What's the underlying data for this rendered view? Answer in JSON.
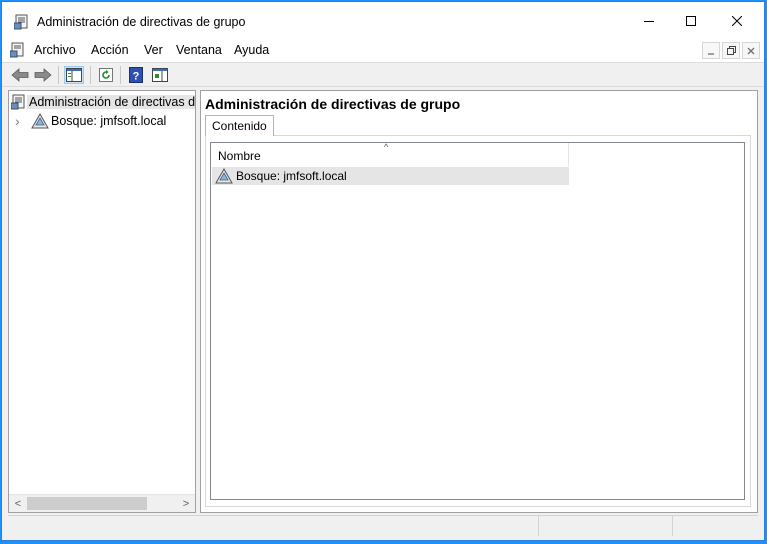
{
  "window": {
    "title": "Administración de directivas de grupo",
    "icon": "gpmc-icon",
    "controls": [
      "minimize",
      "maximize",
      "close"
    ]
  },
  "menu": {
    "items": [
      "Archivo",
      "Acción",
      "Ver",
      "Ventana",
      "Ayuda"
    ]
  },
  "toolbar": {
    "buttons": [
      "back-arrow-icon",
      "forward-arrow-icon",
      "show-hide-tree-icon",
      "refresh-icon",
      "help-icon",
      "action-pane-icon"
    ]
  },
  "tree": {
    "root": "Administración de directivas d",
    "children": [
      {
        "label": "Bosque: jmfsoft.local",
        "expand": "›"
      }
    ]
  },
  "content": {
    "title": "Administración de directivas de grupo",
    "tab": "Contenido",
    "column": "Nombre",
    "sort_glyph": "^",
    "rows": [
      "Bosque: jmfsoft.local"
    ]
  },
  "scroll": {
    "left": "<",
    "right": ">"
  }
}
